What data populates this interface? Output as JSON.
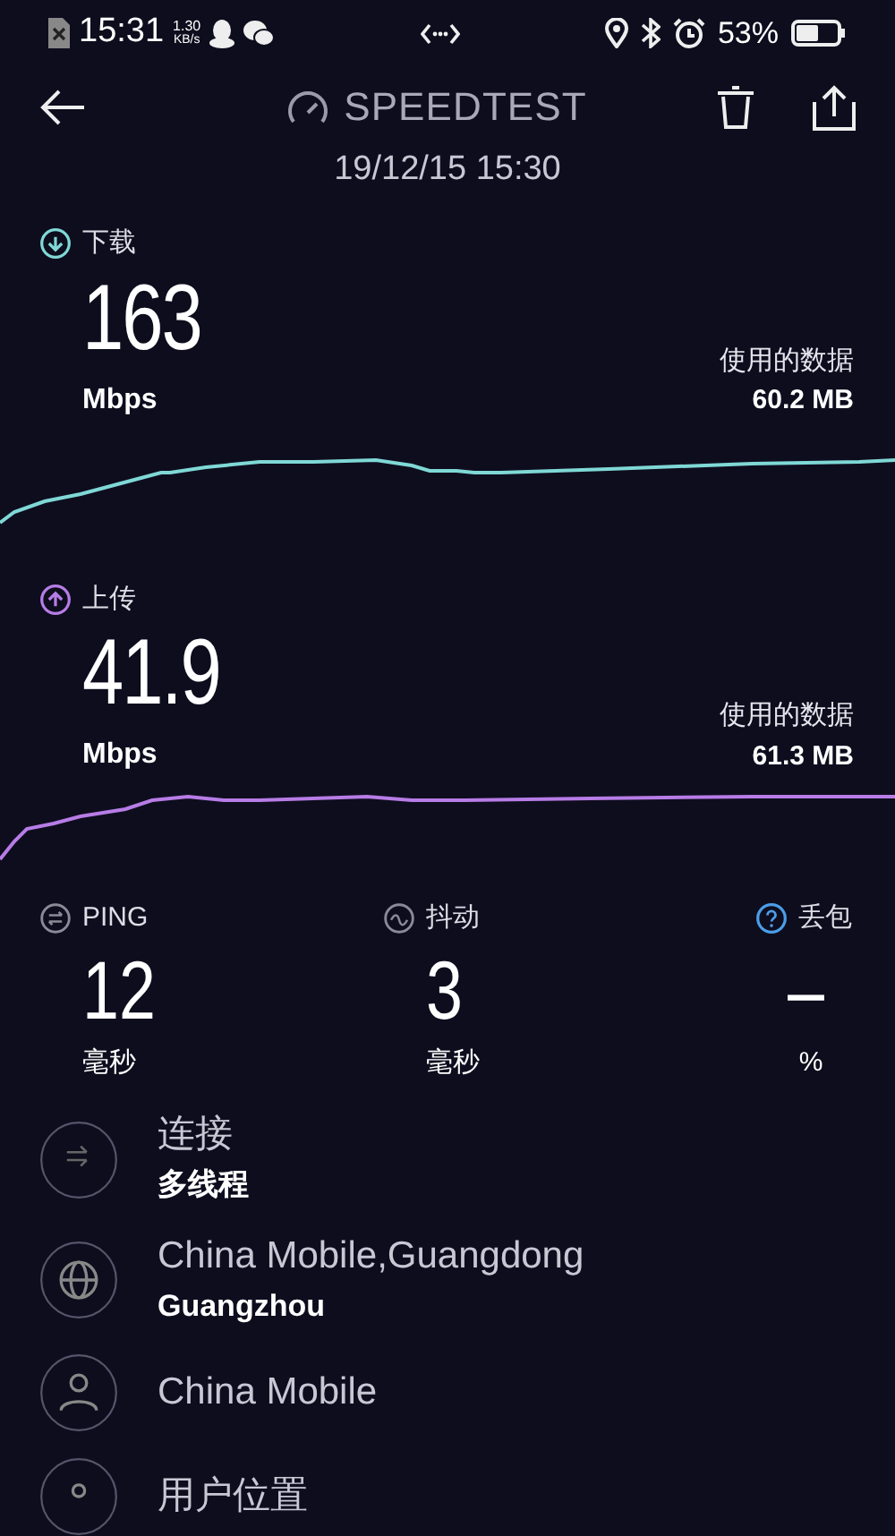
{
  "status_bar": {
    "time": "15:31",
    "net_speed": "1.30",
    "net_unit": "KB/s",
    "battery": "53%"
  },
  "header": {
    "title": "SPEEDTEST",
    "date": "19/12/15 15:30"
  },
  "results": [
    {
      "kind": "download",
      "label": "下载",
      "value": "163",
      "unit": "Mbps",
      "data_label": "使用的数据",
      "data_value": "60.2 MB"
    },
    {
      "kind": "upload",
      "label": "上传",
      "value": "41.9",
      "unit": "Mbps",
      "data_label": "使用的数据",
      "data_value": "61.3 MB"
    }
  ],
  "stats": [
    {
      "kind": "ping",
      "label": "PING",
      "value": "12",
      "unit": "毫秒"
    },
    {
      "kind": "jitter",
      "label": "抖动",
      "value": "3",
      "unit": "毫秒"
    },
    {
      "kind": "loss",
      "label": "丢包",
      "value": "–",
      "unit": "%"
    }
  ],
  "details": [
    {
      "kind": "connection",
      "title": "连接",
      "subtitle": "多线程"
    },
    {
      "kind": "server",
      "title": "China Mobile,Guangdong",
      "subtitle": "Guangzhou"
    },
    {
      "kind": "provider",
      "title": "China Mobile"
    },
    {
      "kind": "location",
      "title": "用户位置"
    }
  ]
}
